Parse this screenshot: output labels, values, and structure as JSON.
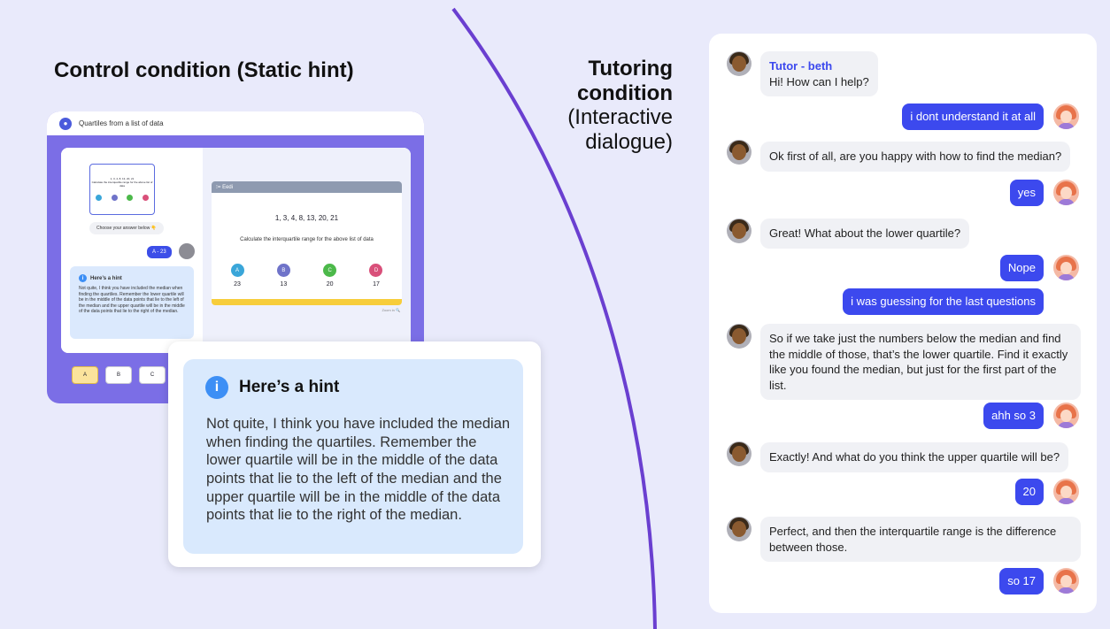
{
  "left": {
    "title": "Control condition (Static hint)",
    "app": {
      "header_title": "Quartiles from a list of data",
      "thumb_question": "1, 3, 4, 8, 13, 20, 21",
      "thumb_prompt": "Calculate the interquartile range for the above list of data",
      "choose_text": "Choose your answer below 👇",
      "answer_chip": "A - 23",
      "small_hint_title": "Here’s a hint",
      "small_hint_text": "Not quite, I think you have included the median when finding the quartiles. Remember the lower quartile will be in the middle of the data points that lie to the left of the median and the upper quartile will be in the middle of the data points that lie to the right of the median.",
      "eedi_label": "⁝= Eedi",
      "question_numbers": "1, 3, 4, 8, 13, 20, 21",
      "question_prompt": "Calculate the interquartile range for the above list of data",
      "options": [
        {
          "letter": "A",
          "value": "23",
          "color": "#3aa6d9"
        },
        {
          "letter": "B",
          "value": "13",
          "color": "#6f73c9"
        },
        {
          "letter": "C",
          "value": "20",
          "color": "#4cb94a"
        },
        {
          "letter": "D",
          "value": "17",
          "color": "#d9507a"
        }
      ],
      "zoom_label": "Zoom in 🔍",
      "answer_buttons": [
        "A",
        "B",
        "C"
      ]
    },
    "hint": {
      "icon": "i",
      "title": "Here’s a hint",
      "text": "Not quite, I think you have included the median when finding the quartiles. Remember the lower quartile will be in the middle of the data points that lie to the left of the median and the upper quartile will be in the middle of the data points that lie to the right of the median."
    }
  },
  "right": {
    "title_bold": "Tutoring condition",
    "title_rest": "(Interactive dialogue)",
    "tutor_name": "Tutor - beth",
    "messages": [
      {
        "from": "tutor",
        "text": "Hi! How can I help?"
      },
      {
        "from": "user",
        "text": "i dont understand it at all"
      },
      {
        "from": "tutor",
        "text": "Ok first of all, are you happy with how to find the median?"
      },
      {
        "from": "user",
        "text": "yes"
      },
      {
        "from": "tutor",
        "text": "Great! What about the lower quartile?"
      },
      {
        "from": "user",
        "text": "Nope"
      },
      {
        "from": "user",
        "text": "i was guessing for the last questions"
      },
      {
        "from": "tutor",
        "text": "So if we take just the numbers below the median and find the middle of those, that’s the lower quartile. Find it exactly like you found the median, but just for the first part of the list."
      },
      {
        "from": "user",
        "text": "ahh so 3"
      },
      {
        "from": "tutor",
        "text": "Exactly! And what do you think the upper quartile will be?"
      },
      {
        "from": "user",
        "text": "20"
      },
      {
        "from": "tutor",
        "text": "Perfect, and then the interquartile range is the difference between those."
      },
      {
        "from": "user",
        "text": "so 17"
      }
    ]
  }
}
